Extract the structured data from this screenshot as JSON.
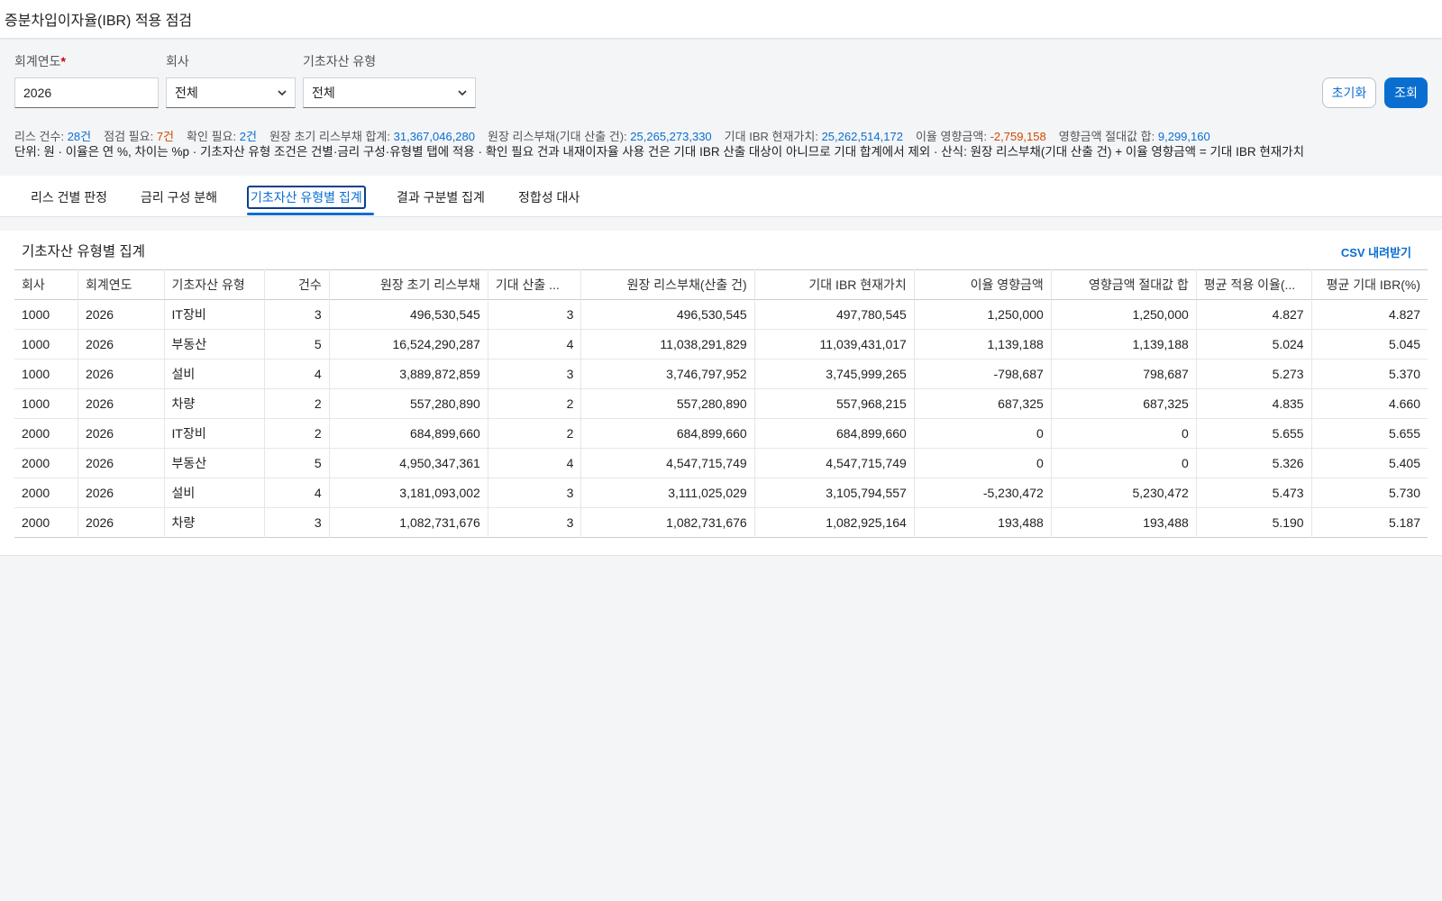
{
  "page": {
    "title": "증분차입이자율(IBR) 적용 점검"
  },
  "filters": {
    "year_label": "회계연도",
    "year_required_mark": "*",
    "year_value": "2026",
    "company_label": "회사",
    "company_value": "전체",
    "asset_label": "기초자산 유형",
    "asset_value": "전체"
  },
  "buttons": {
    "reset": "초기화",
    "query": "조회"
  },
  "stats": [
    {
      "label": "리스 건수:",
      "value": "28건",
      "tone": "blue"
    },
    {
      "label": "점검 필요:",
      "value": "7건",
      "tone": "orange"
    },
    {
      "label": "확인 필요:",
      "value": "2건",
      "tone": "blue"
    },
    {
      "label": "원장 초기 리스부채 합계:",
      "value": "31,367,046,280",
      "tone": "blue"
    },
    {
      "label": "원장 리스부채(기대 산출 건):",
      "value": "25,265,273,330",
      "tone": "blue"
    },
    {
      "label": "기대 IBR 현재가치:",
      "value": "25,262,514,172",
      "tone": "blue"
    },
    {
      "label": "이율 영향금액:",
      "value": "-2,759,158",
      "tone": "orange"
    },
    {
      "label": "영향금액 절대값 합:",
      "value": "9,299,160",
      "tone": "blue"
    }
  ],
  "note": "단위: 원 · 이율은 연 %, 차이는 %p · 기초자산 유형 조건은 건별·금리 구성·유형별 탭에 적용 · 확인 필요 건과 내재이자율 사용 건은 기대 IBR 산출 대상이 아니므로 기대 합계에서 제외 · 산식: 원장 리스부채(기대 산출 건) + 이율 영향금액 = 기대 IBR 현재가치",
  "tabs": [
    "리스 건별 판정",
    "금리 구성 분해",
    "기초자산 유형별 집계",
    "결과 구분별 집계",
    "정합성 대사"
  ],
  "active_tab": 2,
  "panel": {
    "title": "기초자산 유형별 집계",
    "csv_label": "CSV 내려받기"
  },
  "table": {
    "columns": [
      "회사",
      "회계연도",
      "기초자산 유형",
      "건수",
      "원장 초기 리스부채",
      "기대 산출 ...",
      "원장 리스부채(산출 건)",
      "기대 IBR 현재가치",
      "이율 영향금액",
      "영향금액 절대값 합",
      "평균 적용 이율(...",
      "평균 기대 IBR(%)"
    ],
    "rows": [
      [
        "1000",
        "2026",
        "IT장비",
        "3",
        "496,530,545",
        "3",
        "496,530,545",
        "497,780,545",
        "1,250,000",
        "1,250,000",
        "4.827",
        "4.827"
      ],
      [
        "1000",
        "2026",
        "부동산",
        "5",
        "16,524,290,287",
        "4",
        "11,038,291,829",
        "11,039,431,017",
        "1,139,188",
        "1,139,188",
        "5.024",
        "5.045"
      ],
      [
        "1000",
        "2026",
        "설비",
        "4",
        "3,889,872,859",
        "3",
        "3,746,797,952",
        "3,745,999,265",
        "-798,687",
        "798,687",
        "5.273",
        "5.370"
      ],
      [
        "1000",
        "2026",
        "차량",
        "2",
        "557,280,890",
        "2",
        "557,280,890",
        "557,968,215",
        "687,325",
        "687,325",
        "4.835",
        "4.660"
      ],
      [
        "2000",
        "2026",
        "IT장비",
        "2",
        "684,899,660",
        "2",
        "684,899,660",
        "684,899,660",
        "0",
        "0",
        "5.655",
        "5.655"
      ],
      [
        "2000",
        "2026",
        "부동산",
        "5",
        "4,950,347,361",
        "4",
        "4,547,715,749",
        "4,547,715,749",
        "0",
        "0",
        "5.326",
        "5.405"
      ],
      [
        "2000",
        "2026",
        "설비",
        "4",
        "3,181,093,002",
        "3",
        "3,111,025,029",
        "3,105,794,557",
        "-5,230,472",
        "5,230,472",
        "5.473",
        "5.730"
      ],
      [
        "2000",
        "2026",
        "차량",
        "3",
        "1,082,731,676",
        "3",
        "1,082,731,676",
        "1,082,925,164",
        "193,488",
        "193,488",
        "5.190",
        "5.187"
      ]
    ]
  }
}
